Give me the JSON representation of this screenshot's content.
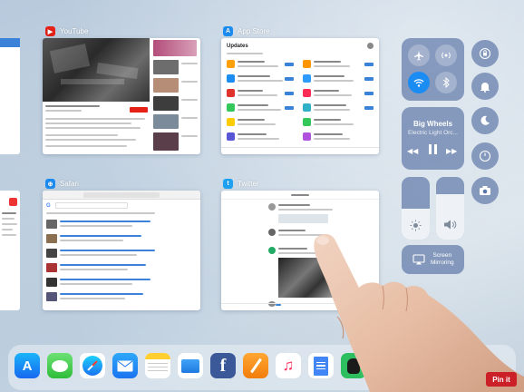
{
  "cards": {
    "youtube": {
      "label": "YouTube",
      "icon": "youtube-icon",
      "accent": "#e62117"
    },
    "appstore": {
      "label": "App Store",
      "icon": "app-store-icon",
      "accent": "#1b8cf2",
      "heading": "Updates"
    },
    "safari": {
      "label": "Safari",
      "icon": "safari-icon",
      "accent": "#1b8cf2"
    },
    "twitter": {
      "label": "Twitter",
      "icon": "twitter-icon",
      "accent": "#1da1f2"
    }
  },
  "control_center": {
    "now_playing_title": "Big Wheels",
    "now_playing_artist": "Electric Light Orc...",
    "screen_mirroring_line1": "Screen",
    "screen_mirroring_line2": "Mirroring",
    "brightness_level": 0.5,
    "volume_level": 0.72,
    "accent": "#1b8cf2"
  },
  "dock": {
    "apps": [
      "app-store-icon",
      "messages-icon",
      "safari-icon",
      "mail-icon",
      "notes-icon",
      "files-icon",
      "facebook-icon",
      "pages-icon",
      "music-icon",
      "docs-icon",
      "evernote-icon",
      "word-icon",
      "unknown-icon",
      "unknown-icon"
    ]
  },
  "pin_button": {
    "label": "Pin it"
  }
}
